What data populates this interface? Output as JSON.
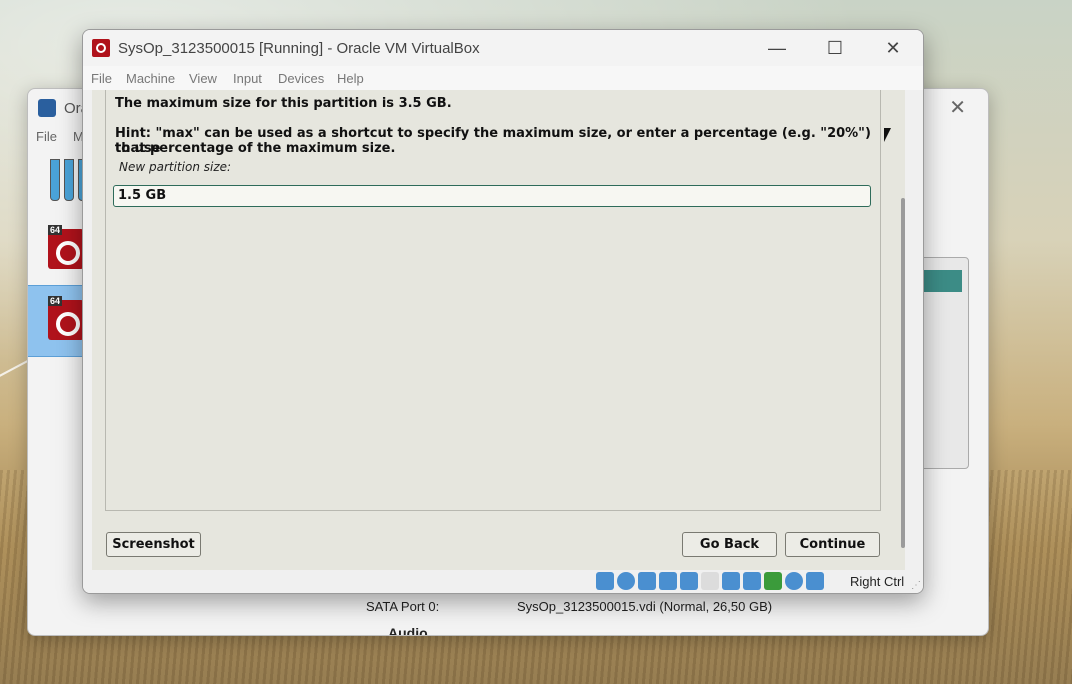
{
  "manager": {
    "title": "Ora",
    "menu": [
      "File",
      "M"
    ],
    "vm_badges": [
      "64",
      "64"
    ],
    "storage_key": "SATA Port 0:",
    "storage_value": "SysOp_3123500015.vdi (Normal, 26,50 GB)",
    "audio_label": "Audio"
  },
  "window": {
    "title": "SysOp_3123500015 [Running] - Oracle VM VirtualBox",
    "menu": [
      "File",
      "Machine",
      "View",
      "Input",
      "Devices",
      "Help"
    ]
  },
  "installer": {
    "max_size_text": "The maximum size for this partition is 3.5 GB.",
    "hint_line1": "Hint: \"max\" can be used as a shortcut to specify the maximum size, or enter a percentage (e.g. \"20%\") to use",
    "hint_line2": "that percentage of the maximum size.",
    "field_label": "New partition size:",
    "field_value": "1.5 GB",
    "screenshot_button": "Screenshot",
    "go_back_button": "Go Back",
    "continue_button": "Continue"
  },
  "status": {
    "host_key": "Right Ctrl",
    "icons": [
      "hard-disk-icon",
      "optical-drive-icon",
      "audio-icon",
      "network-icon",
      "usb-icon",
      "shared-folders-icon",
      "display-icon",
      "recording-icon",
      "cpu-icon",
      "mouse-integration-icon",
      "keyboard-capture-icon"
    ]
  }
}
